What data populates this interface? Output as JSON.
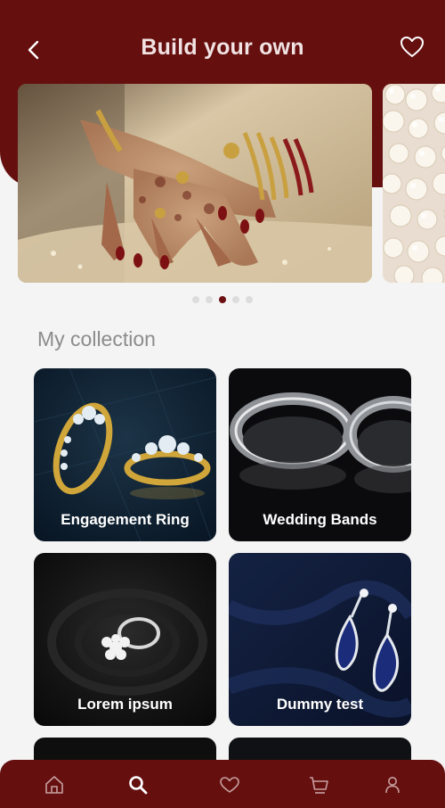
{
  "header": {
    "title": "Build your own",
    "back_icon": "chevron-left-icon",
    "wishlist_icon": "heart-icon"
  },
  "carousel": {
    "slide_count": 5,
    "active_index": 2
  },
  "collection": {
    "title": "My collection",
    "items": [
      {
        "label": "Engagement Ring"
      },
      {
        "label": "Wedding Bands"
      },
      {
        "label": "Lorem ipsum"
      },
      {
        "label": "Dummy test"
      }
    ]
  },
  "bottom_nav": {
    "items": [
      {
        "icon": "home-icon"
      },
      {
        "icon": "search-icon"
      },
      {
        "icon": "heart-icon"
      },
      {
        "icon": "cart-icon"
      },
      {
        "icon": "user-icon"
      }
    ],
    "active_index": 1
  },
  "colors": {
    "brand": "#650f0f",
    "background": "#f4f4f4",
    "active_dot": "#6b0f10",
    "inactive_dot": "#dcdcdc"
  }
}
